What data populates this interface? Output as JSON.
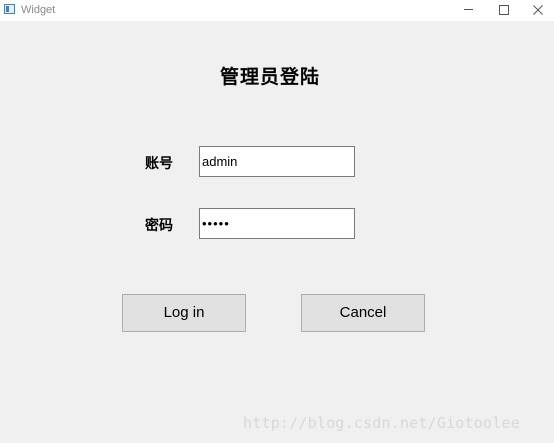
{
  "window": {
    "title": "Widget"
  },
  "form": {
    "heading": "管理员登陆",
    "account_label": "账号",
    "account_value": "admin",
    "password_label": "密码",
    "password_value": "•••••"
  },
  "buttons": {
    "login_label": "Log in",
    "cancel_label": "Cancel"
  },
  "watermark": "http://blog.csdn.net/Giotoolee",
  "icons": {
    "app": "app-window-icon",
    "minimize": "minimize-icon",
    "maximize": "maximize-icon",
    "close": "close-icon"
  },
  "colors": {
    "background": "#f0f0f0",
    "button_face": "#e1e1e1",
    "button_border": "#adadad",
    "field_border": "#7a7a7a"
  }
}
